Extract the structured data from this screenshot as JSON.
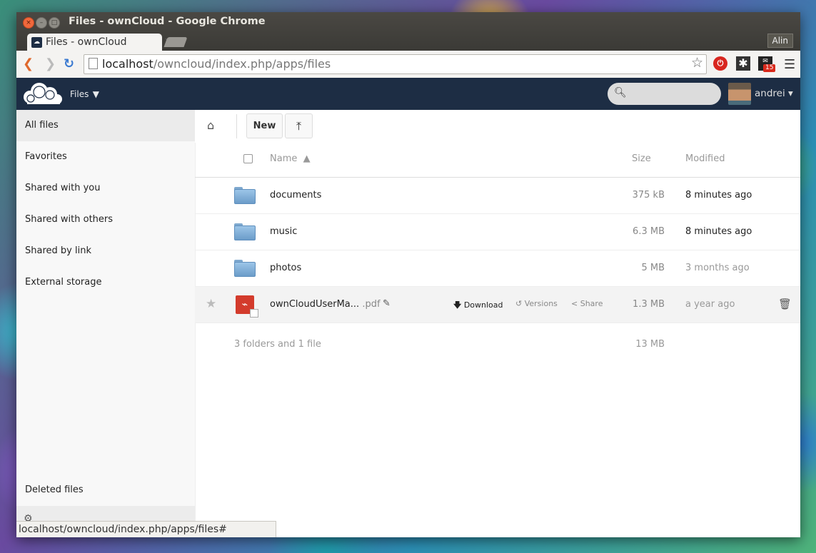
{
  "window": {
    "title": "Files - ownCloud - Google Chrome",
    "tab_label": "Files - ownCloud",
    "profile_name": "Alin"
  },
  "browser": {
    "url_host": "localhost",
    "url_path": "/owncloud/index.php/apps/files",
    "ext_badge": "15"
  },
  "header": {
    "app_name": "Files",
    "search_placeholder": "",
    "user": "andrei"
  },
  "sidebar": {
    "items": [
      {
        "label": "All files"
      },
      {
        "label": "Favorites"
      },
      {
        "label": "Shared with you"
      },
      {
        "label": "Shared with others"
      },
      {
        "label": "Shared by link"
      },
      {
        "label": "External storage"
      }
    ],
    "deleted_label": "Deleted files"
  },
  "controls": {
    "new_label": "New"
  },
  "table": {
    "col_name": "Name",
    "sort_indicator": "▲",
    "col_size": "Size",
    "col_modified": "Modified",
    "rows": [
      {
        "name": "documents",
        "size": "375 kB",
        "modified": "8 minutes ago"
      },
      {
        "name": "music",
        "size": "6.3 MB",
        "modified": "8 minutes ago"
      },
      {
        "name": "photos",
        "size": "5 MB",
        "modified": "3 months ago"
      },
      {
        "name": "ownCloudUserMa...",
        "ext": ".pdf",
        "size": "1.3 MB",
        "modified": "a year ago"
      }
    ],
    "actions": {
      "download": "Download",
      "versions": "Versions",
      "share": "Share"
    },
    "summary_text": "3 folders and 1 file",
    "summary_size": "13 MB"
  },
  "status_url": "localhost/owncloud/index.php/apps/files#",
  "colors": {
    "header_bg": "#1d2d44",
    "sidebar_bg": "#f8f8f8",
    "pdf_red": "#d33b2c"
  }
}
